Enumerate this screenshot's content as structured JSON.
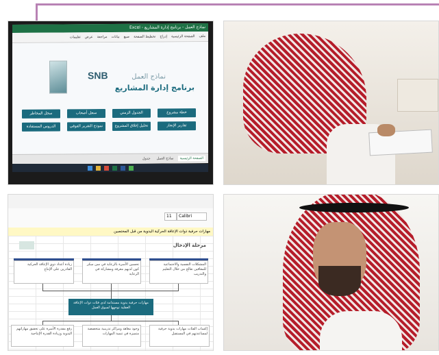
{
  "panel_excel_templates": {
    "titlebar": "نماذج العمل - برنامج إدارة المشاريع - Excel",
    "ribbon_tabs": [
      "ملف",
      "الصفحة الرئيسية",
      "إدراج",
      "تخطيط الصفحة",
      "صيغ",
      "بيانات",
      "مراجعة",
      "عرض",
      "تعليمات"
    ],
    "brand": "SNB",
    "heading_small": "نماذج العمل",
    "heading_main": "برنامج إدارة المشاريع",
    "buttons_row1": [
      "خطة مشروع",
      "الجدول الزمني",
      "سجل أصحاب",
      "سجل المخاطر"
    ],
    "buttons_row2": [
      "تقارير الإنجاز",
      "تحليل إغلاق المشروع",
      "نموذج التقرير الفوقي",
      "الدروس المستفادة"
    ],
    "sheet_tabs": [
      "الصفحة الرئيسية",
      "نماذج العمل",
      "جدول"
    ]
  },
  "panel_excel_diagram": {
    "name_box": "Calibri",
    "font_size": "11",
    "formula_text": "مهارات حرفية ذوات الإعاقة الحركية اليدوية من قبل المختصين",
    "section_title": "مرحلة الإدخال",
    "top_boxes": [
      "المشكلات النفسية والاجتماعية للمعاقين تعالج من خلال التعليم والتدريب",
      "تحسين الأسرة بالرعاية في سن مبكر كون لديهم معرفة ومشاركة في الرعاية",
      "زيادة أعداد ذوي الإعاقة الحركية القادرين على الإنتاج"
    ],
    "center_box": "مهارات حرفية يدوية مستدامة لدى فئات ذوات الإعاقة العقلية توجهها لسوق العمل",
    "bottom_boxes": [
      "إكساب الفئات مهارات يدوية حرفية لمساعدتهم في المستقبل",
      "وجود معاهد ومراكز تدريبية متخصصة متميزة في تنمية المهارات",
      "رفع مقدرة الأسرة على تحقيق مهاراتهم اليدوية وزيادة القدرة الإنتاجية"
    ]
  }
}
